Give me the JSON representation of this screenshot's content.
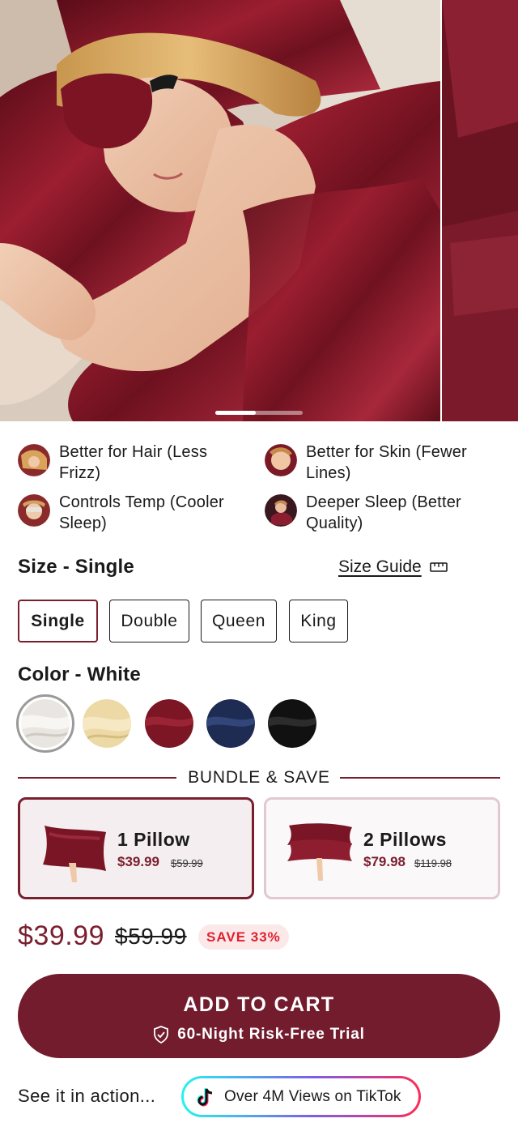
{
  "gallery": {
    "main_image_alt": "Woman sleeping on burgundy satin pillow wearing eye mask",
    "slide_index": 1,
    "slide_count": 2
  },
  "benefits": [
    {
      "label": "Better for Hair (Less Frizz)",
      "icon": "hair-thumb"
    },
    {
      "label": "Better for Skin (Fewer Lines)",
      "icon": "skin-thumb"
    },
    {
      "label": "Controls Temp (Cooler Sleep)",
      "icon": "temp-thumb"
    },
    {
      "label": "Deeper Sleep (Better Quality)",
      "icon": "sleep-thumb"
    }
  ],
  "size": {
    "heading": "Size - Single",
    "guide_label": "Size Guide",
    "options": [
      "Single",
      "Double",
      "Queen",
      "King"
    ],
    "selected": "Single"
  },
  "color": {
    "heading": "Color - White",
    "swatches": [
      {
        "name": "White",
        "hex": "#e9e6e1"
      },
      {
        "name": "Champagne",
        "hex": "#ecd9a6"
      },
      {
        "name": "Burgundy",
        "hex": "#7c1524"
      },
      {
        "name": "Navy",
        "hex": "#1e2c54"
      },
      {
        "name": "Black",
        "hex": "#111111"
      }
    ],
    "selected": "White"
  },
  "bundle": {
    "title": "BUNDLE & SAVE",
    "options": [
      {
        "name": "1 Pillow",
        "price": "$39.99",
        "old_price": "$59.99"
      },
      {
        "name": "2 Pillows",
        "price": "$79.98",
        "old_price": "$119.98"
      }
    ]
  },
  "pricing": {
    "price": "$39.99",
    "old_price": "$59.99",
    "save_badge": "SAVE 33%"
  },
  "cart": {
    "label": "ADD TO CART",
    "trial": "60-Night Risk-Free Trial"
  },
  "social": {
    "label": "See it in action...",
    "tiktok_label": "Over 4M Views on TikTok"
  },
  "colors": {
    "brand": "#721c2d",
    "accent_red": "#e0202e"
  }
}
